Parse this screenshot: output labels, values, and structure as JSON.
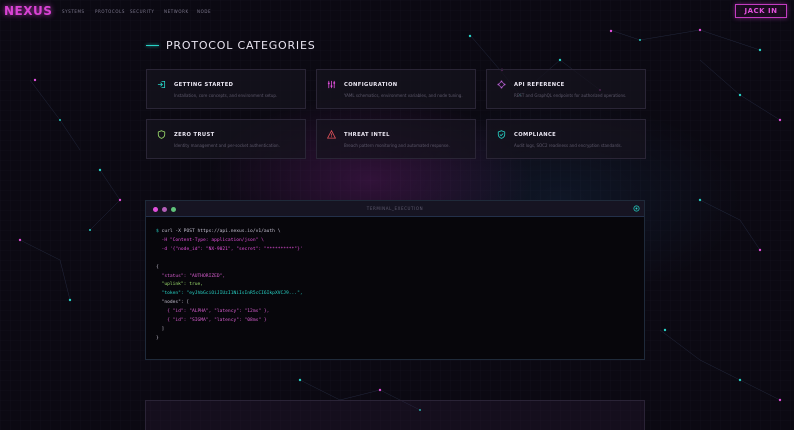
{
  "nav": {
    "logo": "NEXUS",
    "items": [
      "SYSTEMS",
      "PROTOCOLS",
      "SECURITY",
      "NETWORK",
      "NODE"
    ],
    "cta": "JACK IN"
  },
  "section": {
    "title": "PROTOCOL CATEGORIES"
  },
  "cards": [
    {
      "title": "GETTING STARTED",
      "desc": "Installation, core concepts, and environment setup.",
      "icon": "login-arrow-icon",
      "color": "#27d3c6"
    },
    {
      "title": "CONFIGURATION",
      "desc": "YAML schematics, environment variables, and node tuning.",
      "icon": "sliders-icon",
      "color": "#e14fdc"
    },
    {
      "title": "API REFERENCE",
      "desc": "REST and GraphQL endpoints for authorized operations.",
      "icon": "network-icon",
      "color": "#b25ccc"
    },
    {
      "title": "ZERO TRUST",
      "desc": "Identity management and per-socket authentication.",
      "icon": "shield-icon",
      "color": "#9ee06e"
    },
    {
      "title": "THREAT INTEL",
      "desc": "Breach pattern monitoring and automated response.",
      "icon": "warning-icon",
      "color": "#e0525a"
    },
    {
      "title": "COMPLIANCE",
      "desc": "Audit logs, SOC2 readiness and encryption standards.",
      "icon": "shield-check-icon",
      "color": "#27d3c6"
    }
  ],
  "terminal": {
    "title": "TERMINAL_EXECUTION",
    "lines": [
      {
        "p": "$ ",
        "t": "curl -X POST https://api.nexus.io/v1/auth \\"
      },
      {
        "p": "  ",
        "t": "-H \"Content-Type: application/json\" \\"
      },
      {
        "p": "  ",
        "t": "-d '{\"node_id\": \"NX-9021\", \"secret\": \"**********\"}'"
      },
      {
        "p": "",
        "t": ""
      },
      {
        "p": "",
        "t": "{"
      },
      {
        "p": "  ",
        "t": "\"status\": \"AUTHORIZED\","
      },
      {
        "p": "  ",
        "t": "\"uplink\": true,"
      },
      {
        "p": "  ",
        "t": "\"token\": \"eyJhbGciOiJIUzI1NiIsInR5cCI6IkpXVCJ9...\","
      },
      {
        "p": "  ",
        "t": "\"nodes\": ["
      },
      {
        "p": "    ",
        "t": "{ \"id\": \"ALPHA\", \"latency\": \"12ms\" },"
      },
      {
        "p": "    ",
        "t": "{ \"id\": \"SIGMA\", \"latency\": \"08ms\" }"
      },
      {
        "p": "  ",
        "t": "]"
      },
      {
        "p": "",
        "t": "}"
      }
    ]
  },
  "colors": {
    "accent_magenta": "#e14fdc",
    "accent_cyan": "#27d3c6",
    "background": "#0b0912"
  }
}
